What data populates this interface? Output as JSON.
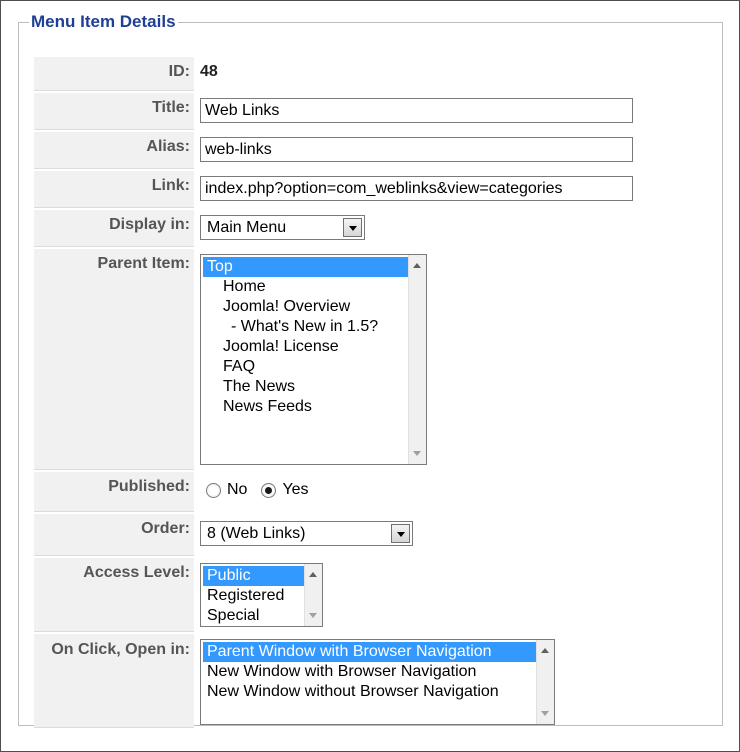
{
  "section_title": "Menu Item Details",
  "fields": {
    "id": {
      "label": "ID:",
      "value": "48"
    },
    "title": {
      "label": "Title:",
      "value": "Web Links"
    },
    "alias": {
      "label": "Alias:",
      "value": "web-links"
    },
    "link": {
      "label": "Link:",
      "value": "index.php?option=com_weblinks&view=categories"
    },
    "display_in": {
      "label": "Display in:",
      "value": "Main Menu"
    },
    "parent_item": {
      "label": "Parent Item:",
      "options": [
        "Top",
        "Home",
        "Joomla! Overview",
        "- What's New in 1.5?",
        "Joomla! License",
        "FAQ",
        "The News",
        "News Feeds"
      ],
      "selected": "Top"
    },
    "published": {
      "label": "Published:",
      "no_label": "No",
      "yes_label": "Yes",
      "selected": "Yes"
    },
    "order": {
      "label": "Order:",
      "value": "8 (Web Links)"
    },
    "access_level": {
      "label": "Access Level:",
      "options": [
        "Public",
        "Registered",
        "Special"
      ],
      "selected": "Public"
    },
    "on_click": {
      "label": "On Click, Open in:",
      "options": [
        "Parent Window with Browser Navigation",
        "New Window with Browser Navigation",
        "New Window without Browser Navigation"
      ],
      "selected": "Parent Window with Browser Navigation"
    }
  }
}
